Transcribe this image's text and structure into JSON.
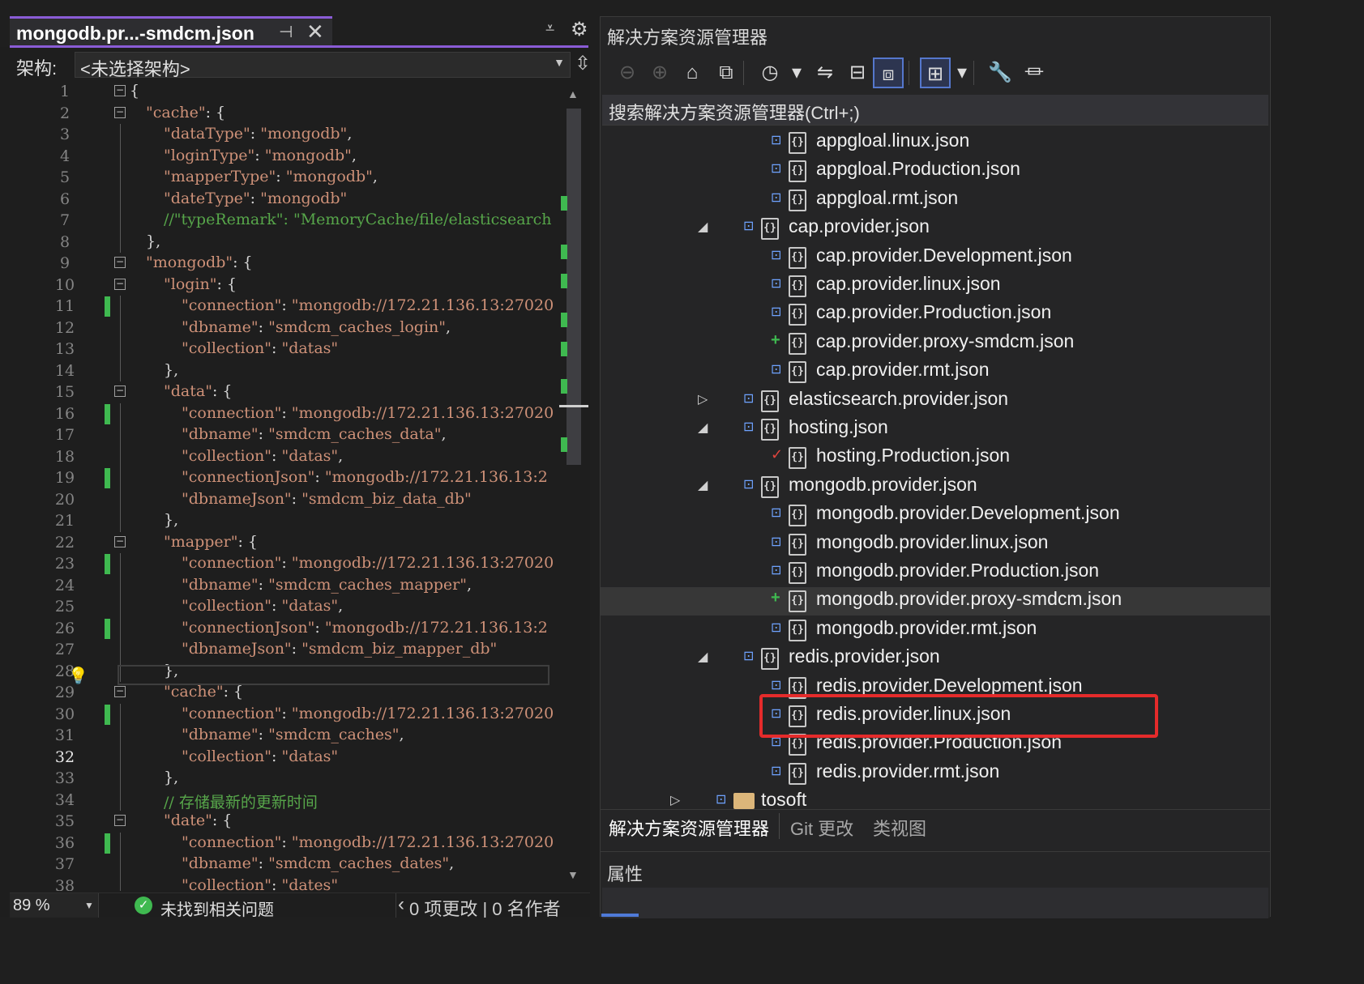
{
  "editor": {
    "tab_title": "mongodb.pr...-smdcm.json",
    "tab_pin_icon": "⊣",
    "tab_close_icon": "✕",
    "arch_label": "架构:",
    "arch_value": "<未选择架构>",
    "zoom": "89 %",
    "status_ok": "未找到相关问题",
    "changes_text": "0 项更改 | 0 名作者"
  },
  "code_lines": [
    {
      "n": "1",
      "fold": "−",
      "indent": 0,
      "tokens": [
        [
          "p",
          "{"
        ]
      ]
    },
    {
      "n": "2",
      "fold": "−",
      "indent": 1,
      "tokens": [
        [
          "k",
          "\"cache\""
        ],
        [
          "p",
          ": {"
        ]
      ]
    },
    {
      "n": "3",
      "indent": 2,
      "tokens": [
        [
          "k",
          "\"dataType\""
        ],
        [
          "p",
          ": "
        ],
        [
          "s",
          "\"mongodb\""
        ],
        [
          "p",
          ","
        ]
      ]
    },
    {
      "n": "4",
      "indent": 2,
      "tokens": [
        [
          "k",
          "\"loginType\""
        ],
        [
          "p",
          ": "
        ],
        [
          "s",
          "\"mongodb\""
        ],
        [
          "p",
          ","
        ]
      ]
    },
    {
      "n": "5",
      "indent": 2,
      "tokens": [
        [
          "k",
          "\"mapperType\""
        ],
        [
          "p",
          ": "
        ],
        [
          "s",
          "\"mongodb\""
        ],
        [
          "p",
          ","
        ]
      ]
    },
    {
      "n": "6",
      "indent": 2,
      "tokens": [
        [
          "k",
          "\"dateType\""
        ],
        [
          "p",
          ": "
        ],
        [
          "s",
          "\"mongodb\""
        ]
      ]
    },
    {
      "n": "7",
      "indent": 2,
      "tokens": [
        [
          "c",
          "//\"typeRemark\": \"MemoryCache/file/elasticsearch"
        ]
      ]
    },
    {
      "n": "8",
      "indent": 1,
      "tokens": [
        [
          "p",
          "},"
        ]
      ]
    },
    {
      "n": "9",
      "fold": "−",
      "indent": 1,
      "tokens": [
        [
          "k",
          "\"mongodb\""
        ],
        [
          "p",
          ": {"
        ]
      ]
    },
    {
      "n": "10",
      "fold": "−",
      "indent": 2,
      "tokens": [
        [
          "k",
          "\"login\""
        ],
        [
          "p",
          ": {"
        ]
      ]
    },
    {
      "n": "11",
      "chg": true,
      "indent": 3,
      "tokens": [
        [
          "k",
          "\"connection\""
        ],
        [
          "p",
          ": "
        ],
        [
          "s",
          "\"mongodb://172.21.136.13:27020"
        ]
      ]
    },
    {
      "n": "12",
      "indent": 3,
      "tokens": [
        [
          "k",
          "\"dbname\""
        ],
        [
          "p",
          ": "
        ],
        [
          "s",
          "\"smdcm_caches_login\""
        ],
        [
          "p",
          ","
        ]
      ]
    },
    {
      "n": "13",
      "indent": 3,
      "tokens": [
        [
          "k",
          "\"collection\""
        ],
        [
          "p",
          ": "
        ],
        [
          "s",
          "\"datas\""
        ]
      ]
    },
    {
      "n": "14",
      "indent": 2,
      "tokens": [
        [
          "p",
          "},"
        ]
      ]
    },
    {
      "n": "15",
      "fold": "−",
      "indent": 2,
      "tokens": [
        [
          "k",
          "\"data\""
        ],
        [
          "p",
          ": {"
        ]
      ]
    },
    {
      "n": "16",
      "chg": true,
      "indent": 3,
      "tokens": [
        [
          "k",
          "\"connection\""
        ],
        [
          "p",
          ": "
        ],
        [
          "s",
          "\"mongodb://172.21.136.13:27020"
        ]
      ]
    },
    {
      "n": "17",
      "indent": 3,
      "tokens": [
        [
          "k",
          "\"dbname\""
        ],
        [
          "p",
          ": "
        ],
        [
          "s",
          "\"smdcm_caches_data\""
        ],
        [
          "p",
          ","
        ]
      ]
    },
    {
      "n": "18",
      "indent": 3,
      "tokens": [
        [
          "k",
          "\"collection\""
        ],
        [
          "p",
          ": "
        ],
        [
          "s",
          "\"datas\""
        ],
        [
          "p",
          ","
        ]
      ]
    },
    {
      "n": "19",
      "chg": true,
      "indent": 3,
      "tokens": [
        [
          "k",
          "\"connectionJson\""
        ],
        [
          "p",
          ": "
        ],
        [
          "s",
          "\"mongodb://172.21.136.13:2"
        ]
      ]
    },
    {
      "n": "20",
      "indent": 3,
      "tokens": [
        [
          "k",
          "\"dbnameJson\""
        ],
        [
          "p",
          ": "
        ],
        [
          "s",
          "\"smdcm_biz_data_db\""
        ]
      ]
    },
    {
      "n": "21",
      "indent": 2,
      "tokens": [
        [
          "p",
          "},"
        ]
      ]
    },
    {
      "n": "22",
      "fold": "−",
      "indent": 2,
      "tokens": [
        [
          "k",
          "\"mapper\""
        ],
        [
          "p",
          ": {"
        ]
      ]
    },
    {
      "n": "23",
      "chg": true,
      "indent": 3,
      "tokens": [
        [
          "k",
          "\"connection\""
        ],
        [
          "p",
          ": "
        ],
        [
          "s",
          "\"mongodb://172.21.136.13:27020"
        ]
      ]
    },
    {
      "n": "24",
      "indent": 3,
      "tokens": [
        [
          "k",
          "\"dbname\""
        ],
        [
          "p",
          ": "
        ],
        [
          "s",
          "\"smdcm_caches_mapper\""
        ],
        [
          "p",
          ","
        ]
      ]
    },
    {
      "n": "25",
      "indent": 3,
      "tokens": [
        [
          "k",
          "\"collection\""
        ],
        [
          "p",
          ": "
        ],
        [
          "s",
          "\"datas\""
        ],
        [
          "p",
          ","
        ]
      ]
    },
    {
      "n": "26",
      "chg": true,
      "indent": 3,
      "tokens": [
        [
          "k",
          "\"connectionJson\""
        ],
        [
          "p",
          ": "
        ],
        [
          "s",
          "\"mongodb://172.21.136.13:2"
        ]
      ]
    },
    {
      "n": "27",
      "indent": 3,
      "tokens": [
        [
          "k",
          "\"dbnameJson\""
        ],
        [
          "p",
          ": "
        ],
        [
          "s",
          "\"smdcm_biz_mapper_db\""
        ]
      ]
    },
    {
      "n": "28",
      "indent": 2,
      "tokens": [
        [
          "p",
          "},"
        ]
      ]
    },
    {
      "n": "29",
      "fold": "−",
      "indent": 2,
      "tokens": [
        [
          "k",
          "\"cache\""
        ],
        [
          "p",
          ": {"
        ]
      ]
    },
    {
      "n": "30",
      "chg": true,
      "indent": 3,
      "tokens": [
        [
          "k",
          "\"connection\""
        ],
        [
          "p",
          ": "
        ],
        [
          "s",
          "\"mongodb://172.21.136.13:27020"
        ]
      ]
    },
    {
      "n": "31",
      "indent": 3,
      "tokens": [
        [
          "k",
          "\"dbname\""
        ],
        [
          "p",
          ": "
        ],
        [
          "s",
          "\"smdcm_caches\""
        ],
        [
          "p",
          ","
        ]
      ]
    },
    {
      "n": "32",
      "active": true,
      "indent": 3,
      "tokens": [
        [
          "k",
          "\"collection\""
        ],
        [
          "p",
          ": "
        ],
        [
          "s",
          "\"datas\""
        ]
      ]
    },
    {
      "n": "33",
      "indent": 2,
      "tokens": [
        [
          "p",
          "},"
        ]
      ]
    },
    {
      "n": "34",
      "indent": 2,
      "tokens": [
        [
          "c",
          "// 存储最新的更新时间"
        ]
      ]
    },
    {
      "n": "35",
      "fold": "−",
      "indent": 2,
      "tokens": [
        [
          "k",
          "\"date\""
        ],
        [
          "p",
          ": {"
        ]
      ]
    },
    {
      "n": "36",
      "chg": true,
      "indent": 3,
      "tokens": [
        [
          "k",
          "\"connection\""
        ],
        [
          "p",
          ": "
        ],
        [
          "s",
          "\"mongodb://172.21.136.13:27020"
        ]
      ]
    },
    {
      "n": "37",
      "indent": 3,
      "tokens": [
        [
          "k",
          "\"dbname\""
        ],
        [
          "p",
          ": "
        ],
        [
          "s",
          "\"smdcm_caches_dates\""
        ],
        [
          "p",
          ","
        ]
      ]
    },
    {
      "n": "38",
      "indent": 3,
      "tokens": [
        [
          "k",
          "\"collection\""
        ],
        [
          "p",
          ": "
        ],
        [
          "s",
          "\"dates\""
        ]
      ]
    }
  ],
  "explorer": {
    "title": "解决方案资源管理器",
    "search_placeholder": "搜索解决方案资源管理器(Ctrl+;)",
    "toolbar": [
      {
        "name": "back-icon",
        "glyph": "⊖",
        "dim": true
      },
      {
        "name": "forward-icon",
        "glyph": "⊕",
        "dim": true
      },
      {
        "name": "home-icon",
        "glyph": "⌂"
      },
      {
        "name": "switch-views-icon",
        "glyph": "⧉"
      },
      {
        "name": "pending-changes-filter-icon",
        "glyph": "◷"
      },
      {
        "name": "dropdown-icon",
        "glyph": "▾"
      },
      {
        "name": "sync-icon",
        "glyph": "⇋"
      },
      {
        "name": "collapse-all-icon",
        "glyph": "⊟"
      },
      {
        "name": "show-all-files-icon",
        "glyph": "⧈",
        "on": true
      },
      {
        "name": "preview-icon",
        "glyph": "⊞",
        "on": true
      },
      {
        "name": "dropdown-icon",
        "glyph": "▾"
      },
      {
        "name": "properties-wrench-icon",
        "glyph": "🔧"
      },
      {
        "name": "preview-pane-icon",
        "glyph": "⏛"
      }
    ],
    "tree": [
      {
        "label": "appgloal.linux.json",
        "level": 2,
        "badge": "lock"
      },
      {
        "label": "appgloal.Production.json",
        "level": 2,
        "badge": "lock"
      },
      {
        "label": "appgloal.rmt.json",
        "level": 2,
        "badge": "lock"
      },
      {
        "label": "cap.provider.json",
        "level": 1,
        "badge": "lock",
        "expander": "open"
      },
      {
        "label": "cap.provider.Development.json",
        "level": 2,
        "badge": "lock"
      },
      {
        "label": "cap.provider.linux.json",
        "level": 2,
        "badge": "lock"
      },
      {
        "label": "cap.provider.Production.json",
        "level": 2,
        "badge": "lock"
      },
      {
        "label": "cap.provider.proxy-smdcm.json",
        "level": 2,
        "badge": "plus"
      },
      {
        "label": "cap.provider.rmt.json",
        "level": 2,
        "badge": "lock"
      },
      {
        "label": "elasticsearch.provider.json",
        "level": 1,
        "badge": "lock",
        "expander": "closed"
      },
      {
        "label": "hosting.json",
        "level": 1,
        "badge": "lock",
        "expander": "open"
      },
      {
        "label": "hosting.Production.json",
        "level": 2,
        "badge": "check"
      },
      {
        "label": "mongodb.provider.json",
        "level": 1,
        "badge": "lock",
        "expander": "open"
      },
      {
        "label": "mongodb.provider.Development.json",
        "level": 2,
        "badge": "lock"
      },
      {
        "label": "mongodb.provider.linux.json",
        "level": 2,
        "badge": "lock"
      },
      {
        "label": "mongodb.provider.Production.json",
        "level": 2,
        "badge": "lock"
      },
      {
        "label": "mongodb.provider.proxy-smdcm.json",
        "level": 2,
        "badge": "plus",
        "selected": true
      },
      {
        "label": "mongodb.provider.rmt.json",
        "level": 2,
        "badge": "lock"
      },
      {
        "label": "redis.provider.json",
        "level": 1,
        "badge": "lock",
        "expander": "open"
      },
      {
        "label": "redis.provider.Development.json",
        "level": 2,
        "badge": "lock"
      },
      {
        "label": "redis.provider.linux.json",
        "level": 2,
        "badge": "lock"
      },
      {
        "label": "redis.provider.Production.json",
        "level": 2,
        "badge": "lock"
      },
      {
        "label": "redis.provider.rmt.json",
        "level": 2,
        "badge": "lock"
      },
      {
        "label": "tosoft",
        "level": 0,
        "badge": "lock",
        "expander": "closed",
        "folder": true
      }
    ],
    "tabs": [
      "解决方案资源管理器",
      "Git 更改",
      "类视图"
    ],
    "properties_title": "属性"
  },
  "colors": {
    "accent": "#8a5cd6",
    "change_marker": "#3fb950",
    "highlight_box": "#e52b2b",
    "json_string": "#ce9178",
    "comment": "#57a64a"
  }
}
